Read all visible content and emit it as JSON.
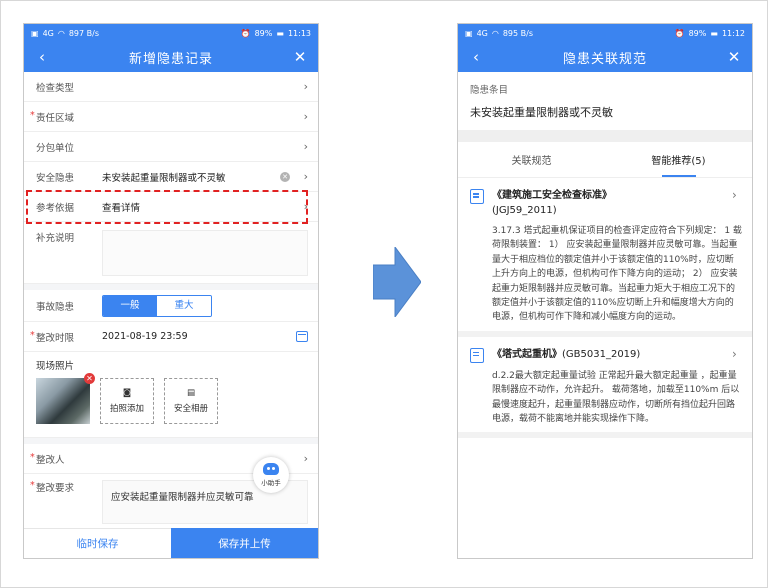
{
  "left": {
    "status": {
      "network": "4G",
      "speed": "897 B/s",
      "battery": "89%",
      "time": "11:13"
    },
    "nav": {
      "back": "‹",
      "title": "新增隐患记录",
      "close": "✕"
    },
    "rows": {
      "check_type": {
        "label": "检查类型",
        "value": ""
      },
      "area": {
        "label": "责任区域",
        "value": ""
      },
      "subcontractor": {
        "label": "分包单位",
        "value": ""
      },
      "hazard": {
        "label": "安全隐患",
        "value": "未安装起重量限制器或不灵敏"
      },
      "basis": {
        "label": "参考依据",
        "value": "查看详情"
      }
    },
    "supplement": {
      "label": "补充说明"
    },
    "accident": {
      "label": "事故隐患",
      "options": [
        "一般",
        "重大"
      ]
    },
    "deadline": {
      "label": "整改时限",
      "value": "2021-08-19 23:59"
    },
    "photos": {
      "label": "现场照片",
      "add_photo": "拍照添加",
      "album": "安全相册"
    },
    "rectifier": {
      "label": "整改人"
    },
    "requirement": {
      "label": "整改要求",
      "value": "应安装起重量限制器并应灵敏可靠"
    },
    "helper": "小助手",
    "footer": {
      "temp_save": "临时保存",
      "save_upload": "保存并上传"
    }
  },
  "right": {
    "status": {
      "network": "4G",
      "speed": "895 B/s",
      "battery": "89%",
      "time": "11:12"
    },
    "nav": {
      "back": "‹",
      "title": "隐患关联规范",
      "close": "✕"
    },
    "hazard_label": "隐患条目",
    "hazard_item": "未安装起重量限制器或不灵敏",
    "tabs": [
      "关联规范",
      "智能推荐(5)"
    ],
    "norms": [
      {
        "title": "《建筑施工安全检查标准》",
        "code": "(JGJ59_2011)",
        "text": "3.17.3 塔式起重机保证项目的检查评定应符合下列规定： 1 载荷限制装置： 1） 应安装起重量限制器并应灵敏可靠。当起重量大于相应档位的额定值并小于该额定值的110%时，应切断上升方向上的电源，但机构可作下降方向的运动； 2） 应安装起重力矩限制器并应灵敏可靠。当起重力矩大于相应工况下的额定值并小于该额定值的110%应切断上升和幅度增大方向的电源，但机构可作下降和减小幅度方向的运动。"
      },
      {
        "title": "《塔式起重机》",
        "code": "(GB5031_2019)",
        "text": "d.2.2最大额定起重量试验 正常起升最大额定起重量 ，起重量限制器应不动作，允许起升。 载荷落地，加载至110%m 后以最慢速度起升，起重量限制器应动作，切断所有挡位起升回路电源，载荷不能离地并能实现操作下降。"
      }
    ]
  },
  "colors": {
    "primary": "#3b84f0",
    "highlight": "#e12121",
    "required": "#e63b3b"
  }
}
